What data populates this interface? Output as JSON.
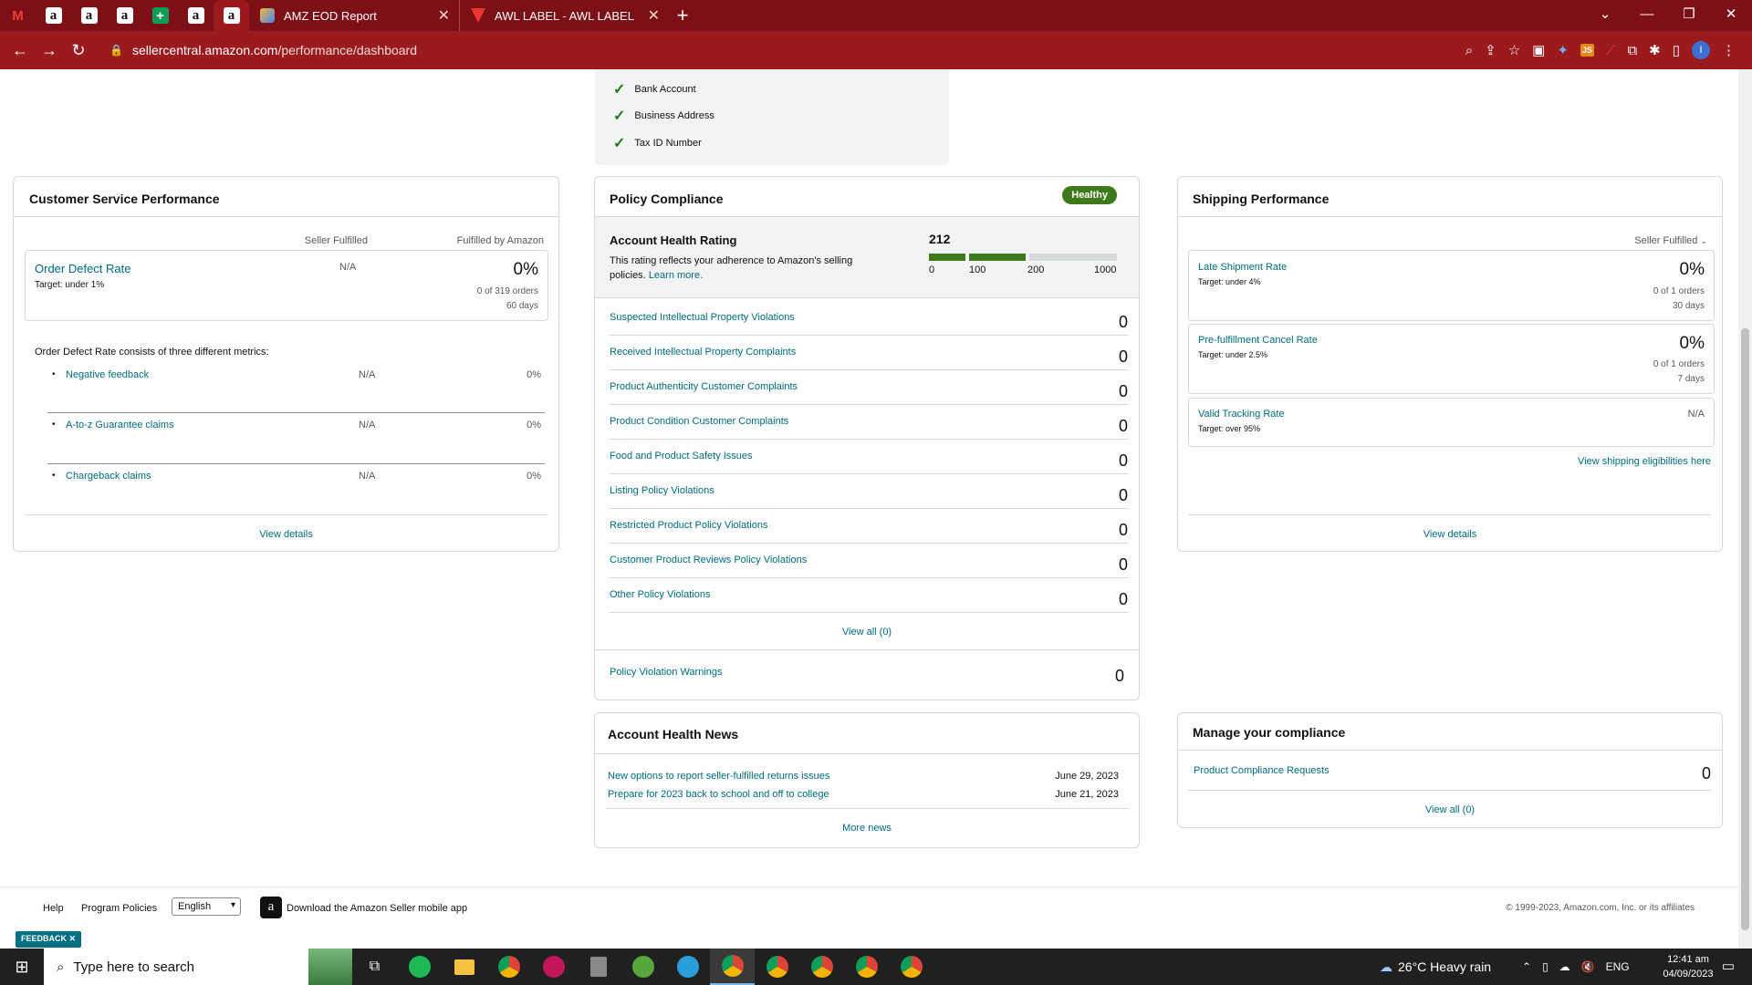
{
  "browser": {
    "pinned_tabs": [
      {
        "name": "gmail-tab",
        "glyph": "M",
        "color": "#ea4335"
      },
      {
        "name": "amazon-tab-1",
        "glyph": "a",
        "color": "#111"
      },
      {
        "name": "amazon-tab-2",
        "glyph": "a",
        "color": "#111"
      },
      {
        "name": "amazon-tab-3",
        "glyph": "a",
        "color": "#111"
      },
      {
        "name": "sheets-tab",
        "glyph": "+",
        "color": "#0f9d58"
      },
      {
        "name": "amazon-tab-4",
        "glyph": "a",
        "color": "#111"
      },
      {
        "name": "amazon-tab-5",
        "glyph": "a",
        "color": "#111"
      }
    ],
    "tabs": [
      {
        "title": "AMZ EOD Report"
      },
      {
        "title": "AWL LABEL - AWL LABEL"
      }
    ],
    "url_host": "sellercentral.amazon.com",
    "url_path": "/performance/dashboard"
  },
  "verification": {
    "items": [
      "Bank Account",
      "Business Address",
      "Tax ID Number"
    ]
  },
  "customer_service": {
    "title": "Customer Service Performance",
    "col_seller": "Seller Fulfilled",
    "col_fba": "Fulfilled by Amazon",
    "odr_label": "Order Defect Rate",
    "odr_target": "Target: under 1%",
    "odr_seller": "N/A",
    "odr_fba": "0%",
    "odr_orders": "0 of 319 orders",
    "odr_days": "60 days",
    "metrics_intro": "Order Defect Rate consists of three different metrics:",
    "metrics": [
      {
        "label": "Negative feedback",
        "seller": "N/A",
        "fba": "0%"
      },
      {
        "label": "A-to-z Guarantee claims",
        "seller": "N/A",
        "fba": "0%"
      },
      {
        "label": "Chargeback claims",
        "seller": "N/A",
        "fba": "0%"
      }
    ],
    "view_details": "View details"
  },
  "policy": {
    "title": "Policy Compliance",
    "status": "Healthy",
    "ahr_title": "Account Health Rating",
    "ahr_desc": "This rating reflects your adherence to Amazon's selling policies.",
    "ahr_learn": "Learn more.",
    "ahr_value": "212",
    "ahr_score": 212,
    "ahr_ticks": [
      "0",
      "100",
      "200",
      "1000"
    ],
    "violations": [
      {
        "label": "Suspected Intellectual Property Violations",
        "value": "0"
      },
      {
        "label": "Received Intellectual Property Complaints",
        "value": "0"
      },
      {
        "label": "Product Authenticity Customer Complaints",
        "value": "0"
      },
      {
        "label": "Product Condition Customer Complaints",
        "value": "0"
      },
      {
        "label": "Food and Product Safety Issues",
        "value": "0"
      },
      {
        "label": "Listing Policy Violations",
        "value": "0"
      },
      {
        "label": "Restricted Product Policy Violations",
        "value": "0"
      },
      {
        "label": "Customer Product Reviews Policy Violations",
        "value": "0"
      },
      {
        "label": "Other Policy Violations",
        "value": "0"
      }
    ],
    "view_all": "View all (0)",
    "warnings_label": "Policy Violation Warnings",
    "warnings_value": "0"
  },
  "news": {
    "title": "Account Health News",
    "items": [
      {
        "label": "New options to report seller-fulfilled returns issues",
        "date": "June 29, 2023"
      },
      {
        "label": "Prepare for 2023 back to school and off to college",
        "date": "June 21, 2023"
      }
    ],
    "more": "More news"
  },
  "shipping": {
    "title": "Shipping Performance",
    "filter": "Seller Fulfilled",
    "metrics": [
      {
        "label": "Late Shipment Rate",
        "target": "Target: under 4%",
        "value": "0%",
        "orders": "0 of 1 orders",
        "days": "30 days"
      },
      {
        "label": "Pre-fulfillment Cancel Rate",
        "target": "Target: under 2.5%",
        "value": "0%",
        "orders": "0 of 1 orders",
        "days": "7 days"
      },
      {
        "label": "Valid Tracking Rate",
        "target": "Target: over 95%",
        "value": "N/A"
      }
    ],
    "eligibility": "View shipping eligibilities here",
    "view_details": "View details"
  },
  "compliance": {
    "title": "Manage your compliance",
    "item_label": "Product Compliance Requests",
    "item_value": "0",
    "view_all": "View all (0)"
  },
  "footer": {
    "help": "Help",
    "policies": "Program Policies",
    "language": "English",
    "app": "Download the Amazon Seller mobile app",
    "copyright": "© 1999-2023, Amazon.com, Inc. or its affiliates",
    "feedback": "FEEDBACK"
  },
  "taskbar": {
    "search_placeholder": "Type here to search",
    "weather": "26°C  Heavy rain",
    "lang": "ENG",
    "time": "12:41 am",
    "date": "04/09/2023"
  }
}
